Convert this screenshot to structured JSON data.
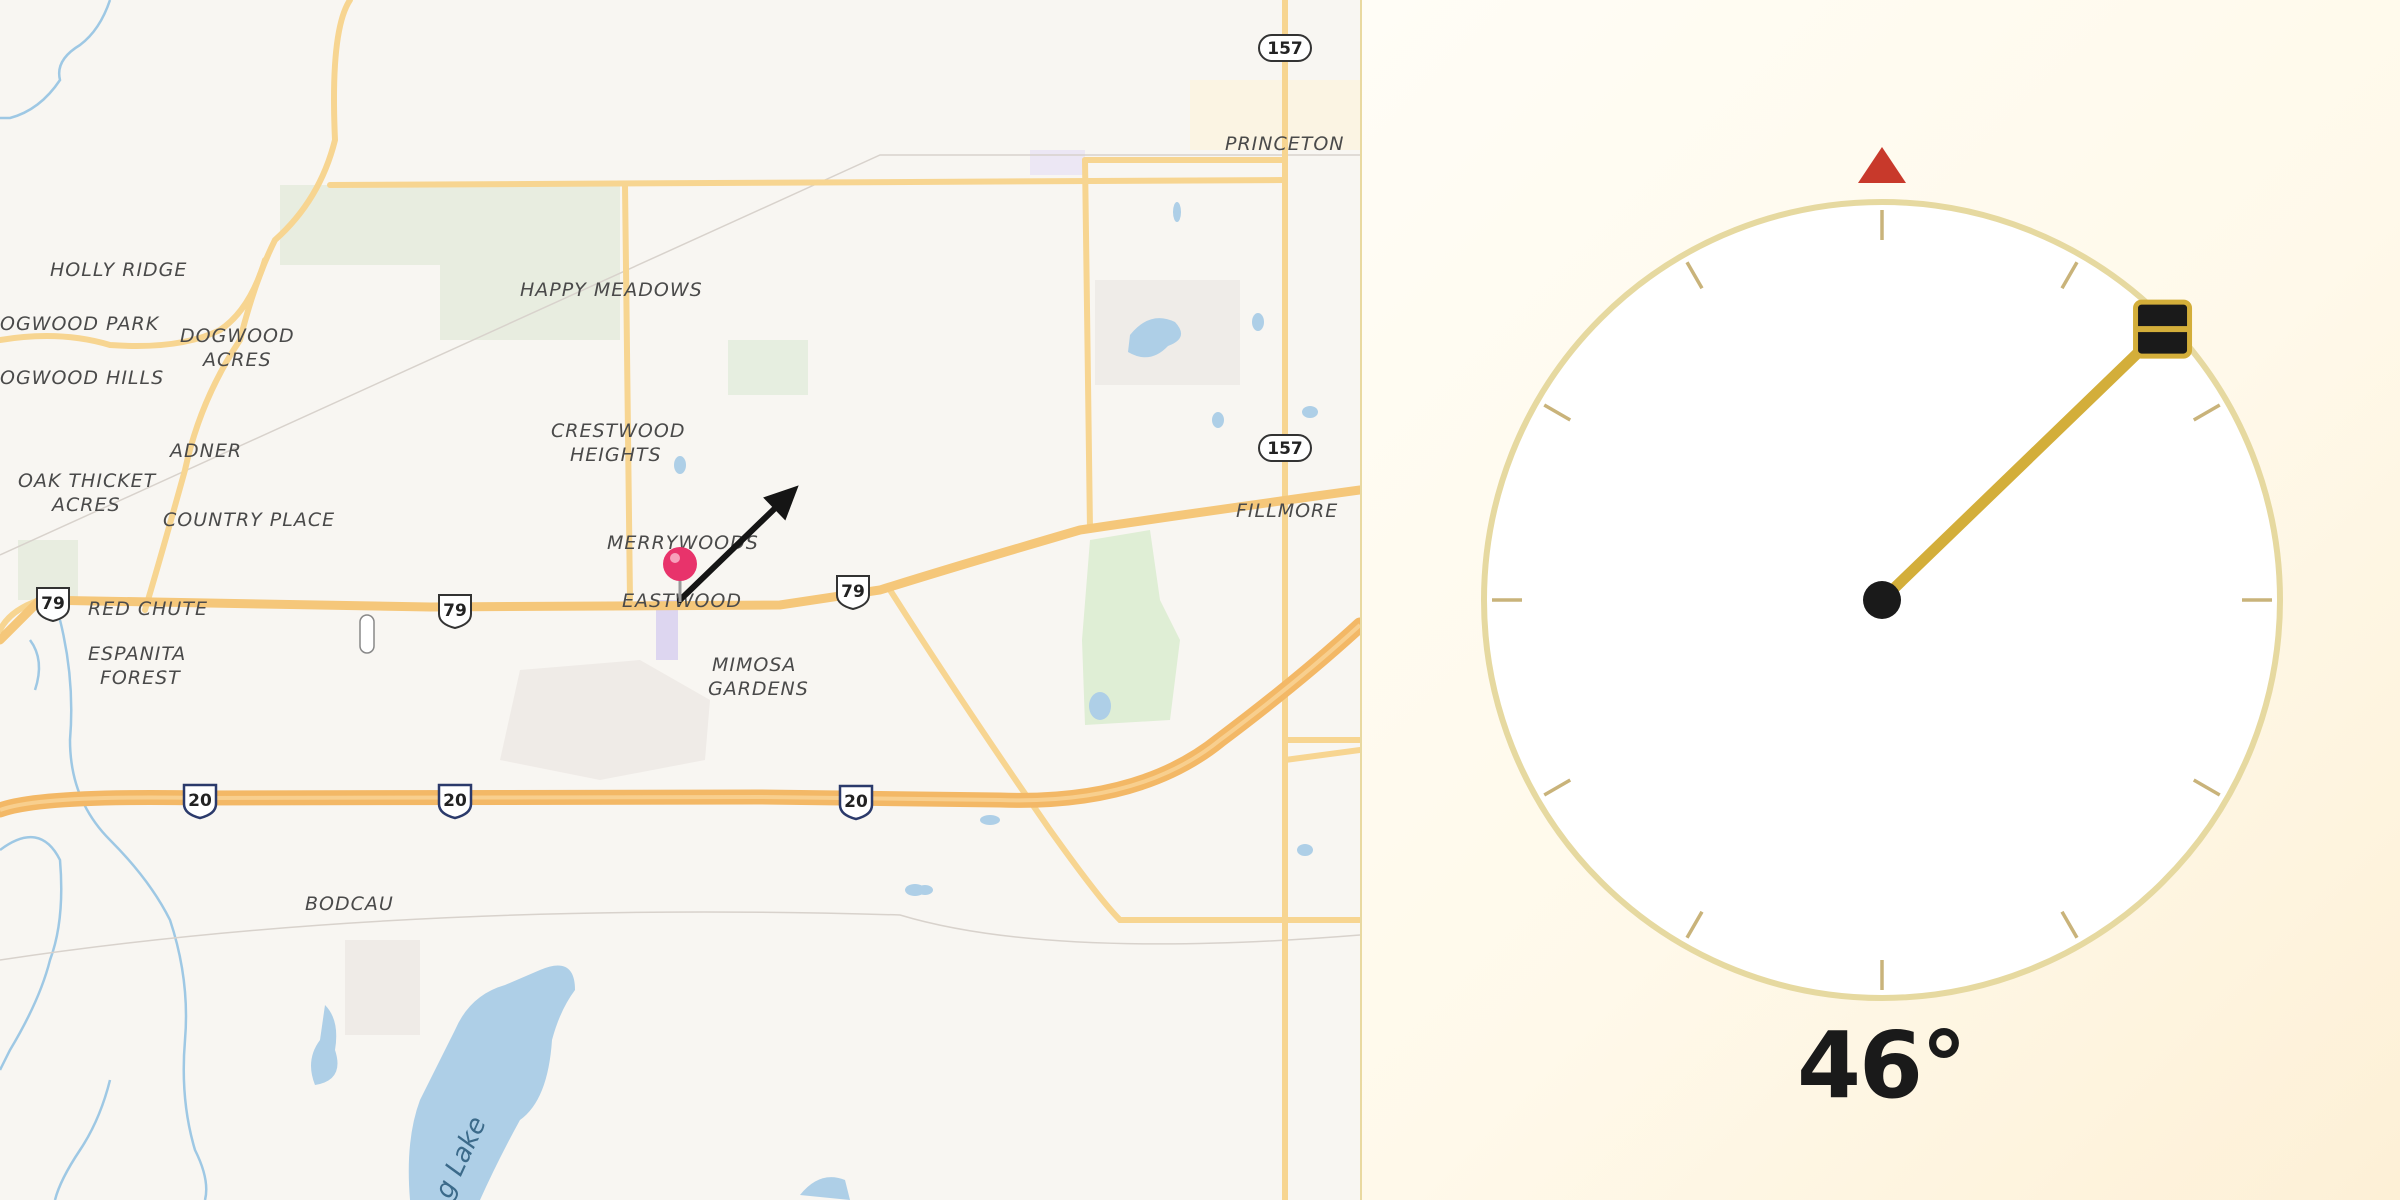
{
  "map": {
    "places": [
      {
        "id": "princeton",
        "text": "PRINCETON"
      },
      {
        "id": "holly-ridge",
        "text": "HOLLY RIDGE"
      },
      {
        "id": "happy-meadows",
        "text": "HAPPY MEADOWS"
      },
      {
        "id": "dogwood-park",
        "text": "OGWOOD PARK"
      },
      {
        "id": "dogwood-acres-1",
        "text": "DOGWOOD"
      },
      {
        "id": "dogwood-acres-2",
        "text": "ACRES"
      },
      {
        "id": "dogwood-hills",
        "text": "OGWOOD HILLS"
      },
      {
        "id": "crestwood-1",
        "text": "CRESTWOOD"
      },
      {
        "id": "crestwood-2",
        "text": "HEIGHTS"
      },
      {
        "id": "adner",
        "text": "ADNER"
      },
      {
        "id": "oak-thicket-1",
        "text": "OAK THICKET"
      },
      {
        "id": "oak-thicket-2",
        "text": "ACRES"
      },
      {
        "id": "fillmore",
        "text": "FILLMORE"
      },
      {
        "id": "country-place",
        "text": "COUNTRY PLACE"
      },
      {
        "id": "merrywoods",
        "text": "MERRYWOODS"
      },
      {
        "id": "red-chute",
        "text": "RED CHUTE"
      },
      {
        "id": "eastwood",
        "text": "EASTWOOD"
      },
      {
        "id": "mimosa-1",
        "text": "MIMOSA"
      },
      {
        "id": "mimosa-2",
        "text": "GARDENS"
      },
      {
        "id": "espanita-1",
        "text": "ESPANITA"
      },
      {
        "id": "espanita-2",
        "text": "FOREST"
      },
      {
        "id": "bodcau",
        "text": "BODCAU"
      }
    ],
    "lake_label": "g Lake",
    "shields": {
      "us79": "79",
      "us157": "157",
      "i20": "20"
    }
  },
  "compass": {
    "heading_deg": 46,
    "heading_text": "46°",
    "colors": {
      "north_marker": "#c8392b",
      "needle": "#d3ae3a",
      "ring": "#e6d9a0",
      "tick": "#c9b37a",
      "hub": "#1a1a1a"
    }
  }
}
